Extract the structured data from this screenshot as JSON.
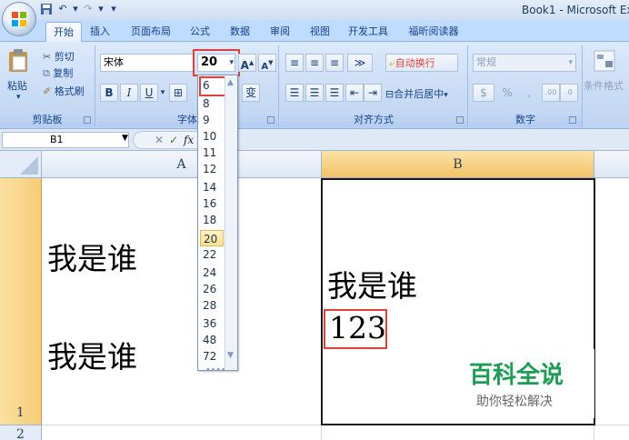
{
  "window": {
    "title": "Book1 - Microsoft Ex"
  },
  "quick_access": {
    "save_icon": "save-icon",
    "undo_glyph": "↶",
    "redo_glyph": "↷",
    "customize_glyph": "▾"
  },
  "tabs": [
    {
      "label": "开始",
      "active": true
    },
    {
      "label": "插入"
    },
    {
      "label": "页面布局"
    },
    {
      "label": "公式"
    },
    {
      "label": "数据"
    },
    {
      "label": "审阅"
    },
    {
      "label": "视图"
    },
    {
      "label": "开发工具"
    },
    {
      "label": "福昕阅读器"
    }
  ],
  "clipboard": {
    "paste_label": "粘贴",
    "cut_label": "剪切",
    "copy_label": "复制",
    "format_painter_label": "格式刷",
    "group_label": "剪贴板"
  },
  "font": {
    "font_name": "宋体",
    "font_size": "20",
    "grow_glyph": "A",
    "shrink_glyph": "A",
    "bold_glyph": "B",
    "italic_glyph": "I",
    "underline_glyph": "U",
    "phonetic_glyph": "变",
    "group_label": "字体"
  },
  "alignment": {
    "wrap_text_label": "自动换行",
    "merge_center_label": "合并后居中",
    "group_label": "对齐方式"
  },
  "number": {
    "format": "常规",
    "percent_glyph": "%",
    "comma_glyph": ",",
    "inc_decimal": ".00",
    "dec_decimal": ".0",
    "group_label": "数字"
  },
  "styles": {
    "conditional_format_label": "条件格式"
  },
  "formula_bar": {
    "name_box": "B1",
    "cancel_glyph": "✕",
    "enter_glyph": "✓",
    "fx_glyph": "fx"
  },
  "font_size_options": [
    "6",
    "8",
    "9",
    "10",
    "11",
    "12",
    "14",
    "16",
    "18",
    "20",
    "22",
    "24",
    "26",
    "28",
    "36",
    "48",
    "72"
  ],
  "font_size_selected": "20",
  "grid": {
    "columns": [
      "A",
      "B"
    ],
    "rows": [
      "1",
      "2"
    ],
    "cell_A1_line1": "我是谁",
    "cell_A1_line2": "我是谁",
    "cell_B1_line1": "我是谁",
    "cell_B1_line2": "123"
  },
  "watermark": {
    "title": "百科全说",
    "subtitle": "助你轻松解决"
  },
  "colors": {
    "highlight_red": "#e0403a",
    "selected_column": "#f3c266",
    "watermark_green": "#1b9e54"
  }
}
